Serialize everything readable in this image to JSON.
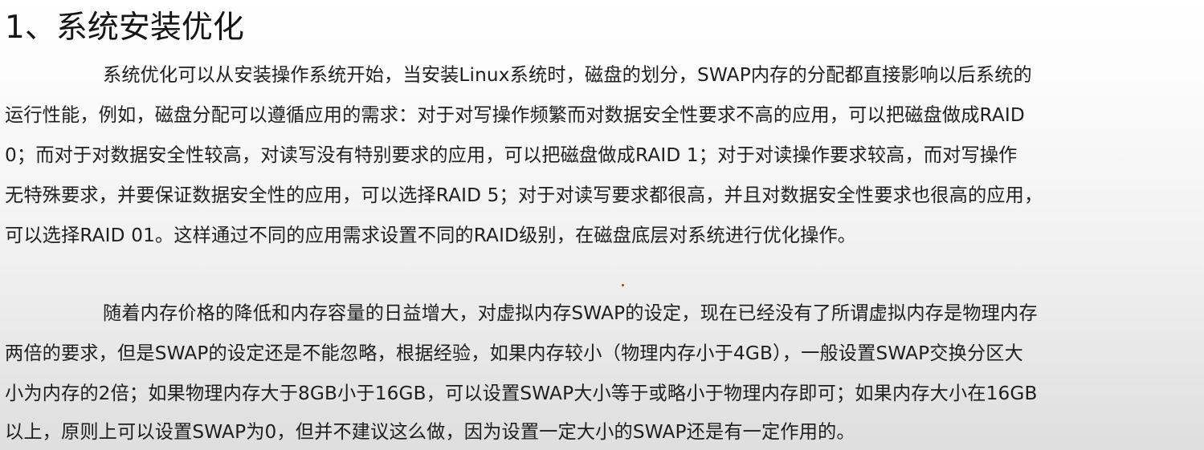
{
  "section": {
    "title": "1、系统安装优化"
  },
  "paragraph1": {
    "lines": [
      "系统优化可以从安装操作系统开始，当安装Linux系统时，磁盘的划分，SWAP内存的分配都直接影响以后系统的",
      "运行性能，例如，磁盘分配可以遵循应用的需求：对于对写操作频繁而对数据安全性要求不高的应用，可以把磁盘做成RAID",
      "0；而对于对数据安全性较高，对读写没有特别要求的应用，可以把磁盘做成RAID 1；对于对读操作要求较高，而对写操作",
      "无特殊要求，并要保证数据安全性的应用，可以选择RAID 5；对于对读写要求都很高，并且对数据安全性要求也很高的应用，",
      "可以选择RAID 01。这样通过不同的应用需求设置不同的RAID级别，在磁盘底层对系统进行优化操作。"
    ]
  },
  "paragraph2": {
    "lines": [
      "随着内存价格的降低和内存容量的日益增大，对虚拟内存SWAP的设定，现在已经没有了所谓虚拟内存是物理内存",
      "两倍的要求，但是SWAP的设定还是不能忽略，根据经验，如果内存较小（物理内存小于4GB），一般设置SWAP交换分区大",
      "小为内存的2倍；如果物理内存大于8GB小于16GB，可以设置SWAP大小等于或略小于物理内存即可；如果内存大小在16GB",
      "以上，原则上可以设置SWAP为0，但并不建议这么做，因为设置一定大小的SWAP还是有一定作用的。"
    ]
  }
}
